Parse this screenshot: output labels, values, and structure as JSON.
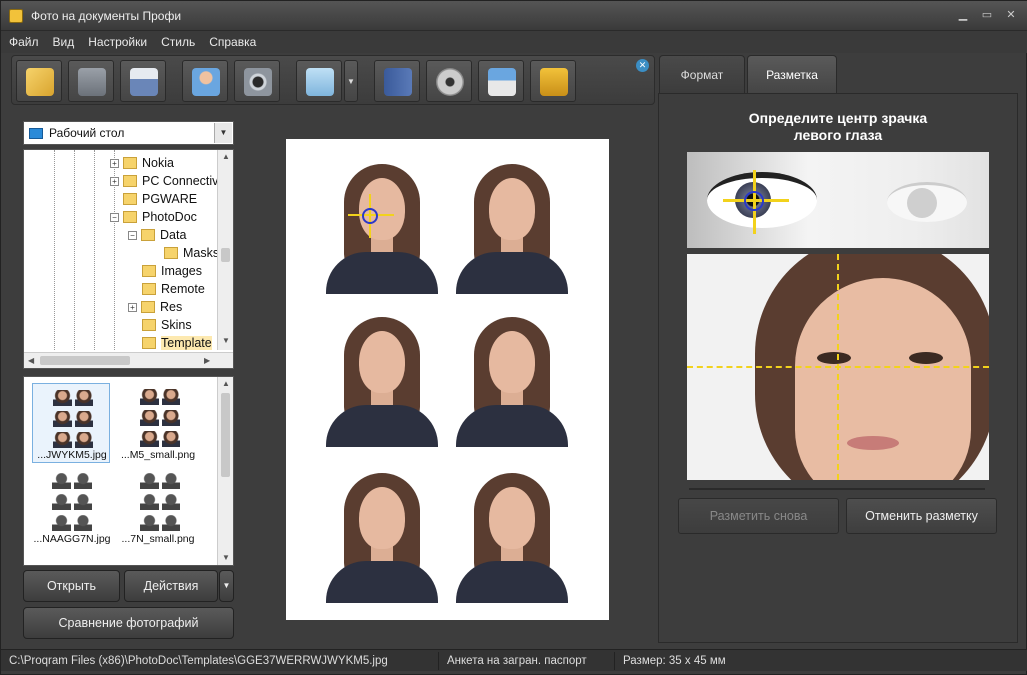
{
  "window": {
    "title": "Фото на документы Профи"
  },
  "menu": [
    "Файл",
    "Вид",
    "Настройки",
    "Стиль",
    "Справка"
  ],
  "toolbar": {
    "icons": [
      "open-folder-icon",
      "save-icon",
      "print-icon",
      "person-icon",
      "camera-icon",
      "screen-capture-icon",
      "help-book-icon",
      "film-icon",
      "home-icon",
      "cart-icon"
    ]
  },
  "left_panel": {
    "folder_select": "Рабочий стол",
    "tree": [
      {
        "label": "Nokia",
        "expander": "+"
      },
      {
        "label": "PC Connectiv",
        "expander": "+"
      },
      {
        "label": "PGWARE",
        "expander": ""
      },
      {
        "label": "PhotoDoc",
        "expander": "−"
      },
      {
        "label": "Data",
        "expander": "−"
      },
      {
        "label": "Masks",
        "expander": ""
      },
      {
        "label": "Images",
        "expander": ""
      },
      {
        "label": "Remote",
        "expander": ""
      },
      {
        "label": "Res",
        "expander": "+"
      },
      {
        "label": "Skins",
        "expander": ""
      },
      {
        "label": "Template",
        "expander": ""
      }
    ],
    "thumbnails": [
      {
        "label": "...JWYKM5.jpg"
      },
      {
        "label": "...M5_small.png"
      },
      {
        "label": "...NAAGG7N.jpg"
      },
      {
        "label": "...7N_small.png"
      }
    ],
    "open_button": "Открыть",
    "actions_button": "Действия",
    "compare_button": "Сравнение фотографий"
  },
  "right_panel": {
    "tabs": [
      "Формат",
      "Разметка"
    ],
    "active_tab": "Разметка",
    "instruction_line1": "Определите центр зрачка",
    "instruction_line2": "левого глаза",
    "remark_button": "Разметить снова",
    "cancel_button": "Отменить разметку"
  },
  "status": {
    "path": "C:\\Proqram Files (x86)\\PhotoDoc\\Templates\\GGE37WERRWJWYKM5.jpg",
    "format": "Анкета на загран. паспорт",
    "size": "Размер: 35 x 45 мм"
  },
  "colors": {
    "accent": "#f2d21c",
    "marker": "#2a39c8"
  }
}
